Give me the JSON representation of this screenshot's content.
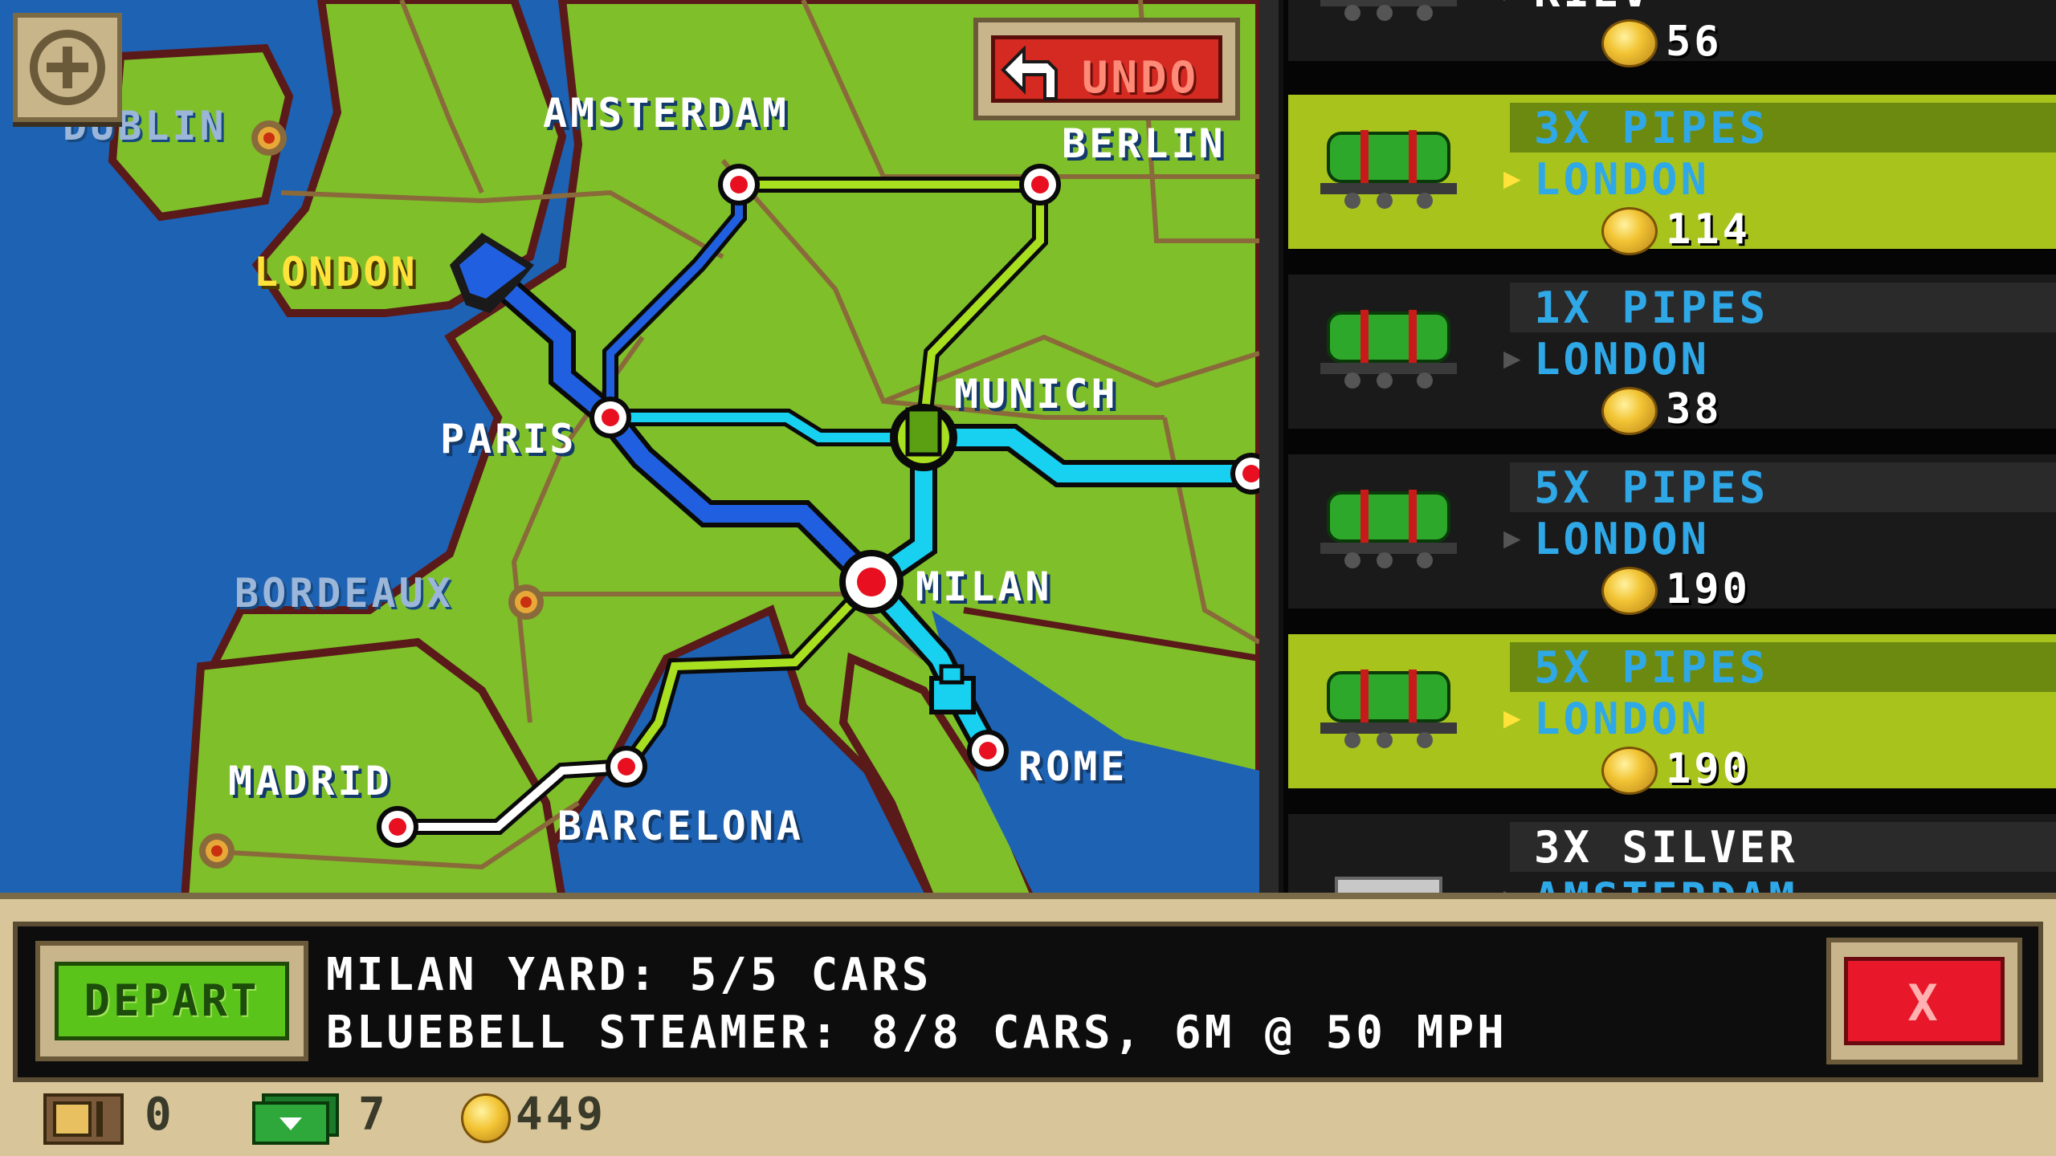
{
  "map": {
    "undo_label": "UNDO",
    "zoom_icon": "plus-icon",
    "cities": {
      "dublin": "DUBLIN",
      "amsterdam": "AMSTERDAM",
      "berlin": "BERLIN",
      "london": "LONDON",
      "paris": "PARIS",
      "munich": "MUNICH",
      "bordeaux": "BORDEAUX",
      "milan": "MILAN",
      "madrid": "MADRID",
      "barcelona": "BARCELONA",
      "rome": "ROME"
    }
  },
  "cargo_list": {
    "items": [
      {
        "cargo": "",
        "destination": "KIEV",
        "price": "56",
        "selected": false
      },
      {
        "cargo": "3X PIPES",
        "destination": "LONDON",
        "price": "114",
        "selected": true
      },
      {
        "cargo": "1X PIPES",
        "destination": "LONDON",
        "price": "38",
        "selected": false
      },
      {
        "cargo": "5X PIPES",
        "destination": "LONDON",
        "price": "190",
        "selected": false
      },
      {
        "cargo": "5X PIPES",
        "destination": "LONDON",
        "price": "190",
        "selected": true
      },
      {
        "cargo": "3X SILVER",
        "destination": "AMSTERDAM",
        "price": "",
        "selected": false
      }
    ]
  },
  "bottom": {
    "depart_label": "DEPART",
    "yard_status": "MILAN YARD: 5/5 CARS",
    "train_status": "BLUEBELL STEAMER: 8/8 CARS, 6M @ 50 MPH",
    "close_label": "X"
  },
  "stats": {
    "crates": "0",
    "cash": "7",
    "coins": "449"
  },
  "colors": {
    "sea": "#1e62b4",
    "land": "#7fbf2a",
    "route_blue": "#2060e0",
    "route_cyan": "#18d0f0",
    "route_lime": "#a8e020",
    "selected_card": "#a8c41c",
    "depart_green": "#5bc41a",
    "close_red": "#e8182a"
  }
}
